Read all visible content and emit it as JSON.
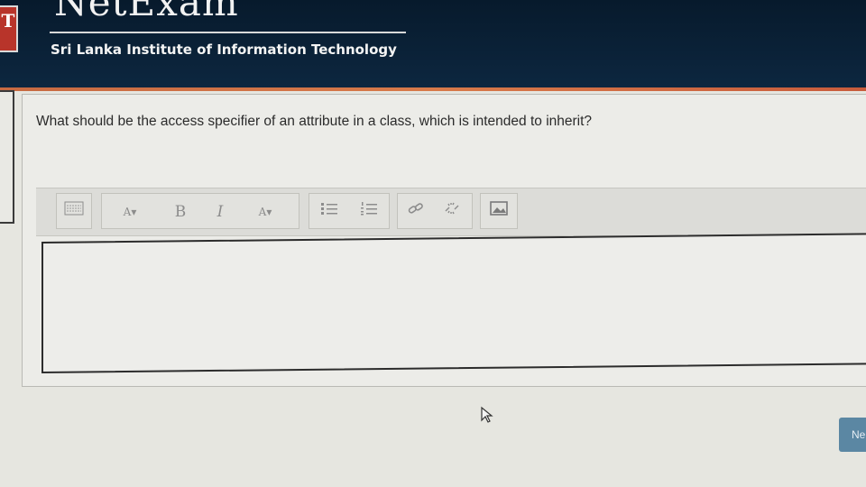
{
  "header": {
    "brand": "NetExam",
    "logo_letter": "T",
    "institution": "Sri Lanka Institute of Information Technology"
  },
  "question": {
    "text": "What should be the access specifier of an attribute in a class, which is intended to  inherit?"
  },
  "toolbar": {
    "font_size_label": "A",
    "bold_label": "B",
    "italic_label": "I",
    "text_color_label": "A"
  },
  "answer": {
    "value": ""
  },
  "footer": {
    "next_label": "Ne"
  },
  "colors": {
    "header_bg": "#0d2740",
    "accent": "#d77a4a",
    "next_button": "#5b87a3"
  }
}
